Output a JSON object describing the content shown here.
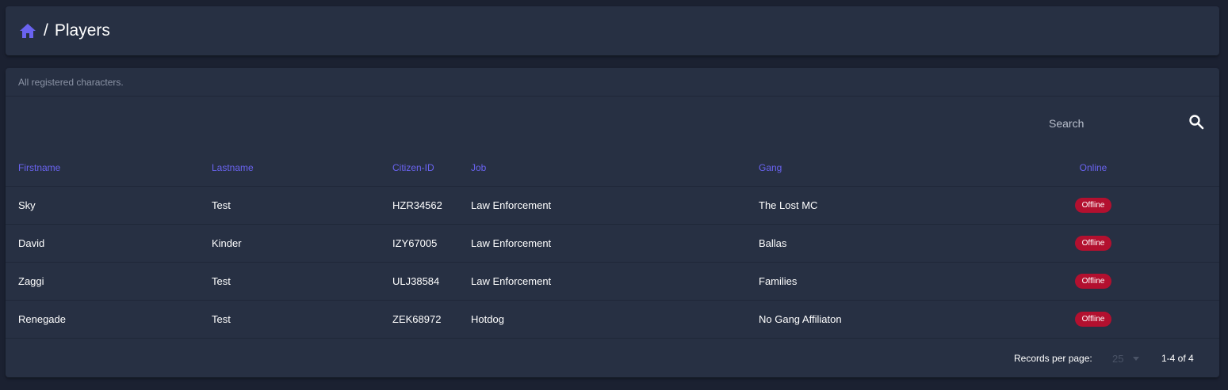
{
  "header": {
    "home_icon": "home-icon",
    "separator": "/",
    "title": "Players"
  },
  "card": {
    "subtitle": "All registered characters."
  },
  "search": {
    "placeholder": "Search",
    "icon": "search-icon"
  },
  "table": {
    "columns": [
      "Firstname",
      "Lastname",
      "Citizen-ID",
      "Job",
      "Gang",
      "Online"
    ],
    "rows": [
      {
        "firstname": "Sky",
        "lastname": "Test",
        "citizen_id": "HZR34562",
        "job": "Law Enforcement",
        "gang": "The Lost MC",
        "online": "Offline"
      },
      {
        "firstname": "David",
        "lastname": "Kinder",
        "citizen_id": "IZY67005",
        "job": "Law Enforcement",
        "gang": "Ballas",
        "online": "Offline"
      },
      {
        "firstname": "Zaggi",
        "lastname": "Test",
        "citizen_id": "ULJ38584",
        "job": "Law Enforcement",
        "gang": "Families",
        "online": "Offline"
      },
      {
        "firstname": "Renegade",
        "lastname": "Test",
        "citizen_id": "ZEK68972",
        "job": "Hotdog",
        "gang": "No Gang Affiliaton",
        "online": "Offline"
      }
    ]
  },
  "footer": {
    "records_per_page_label": "Records per page:",
    "records_per_page_value": "25",
    "range": "1-4 of 4"
  },
  "colors": {
    "background": "#1b2131",
    "card": "#273043",
    "accent": "#6a63f0",
    "offline_badge": "#b3102f"
  }
}
